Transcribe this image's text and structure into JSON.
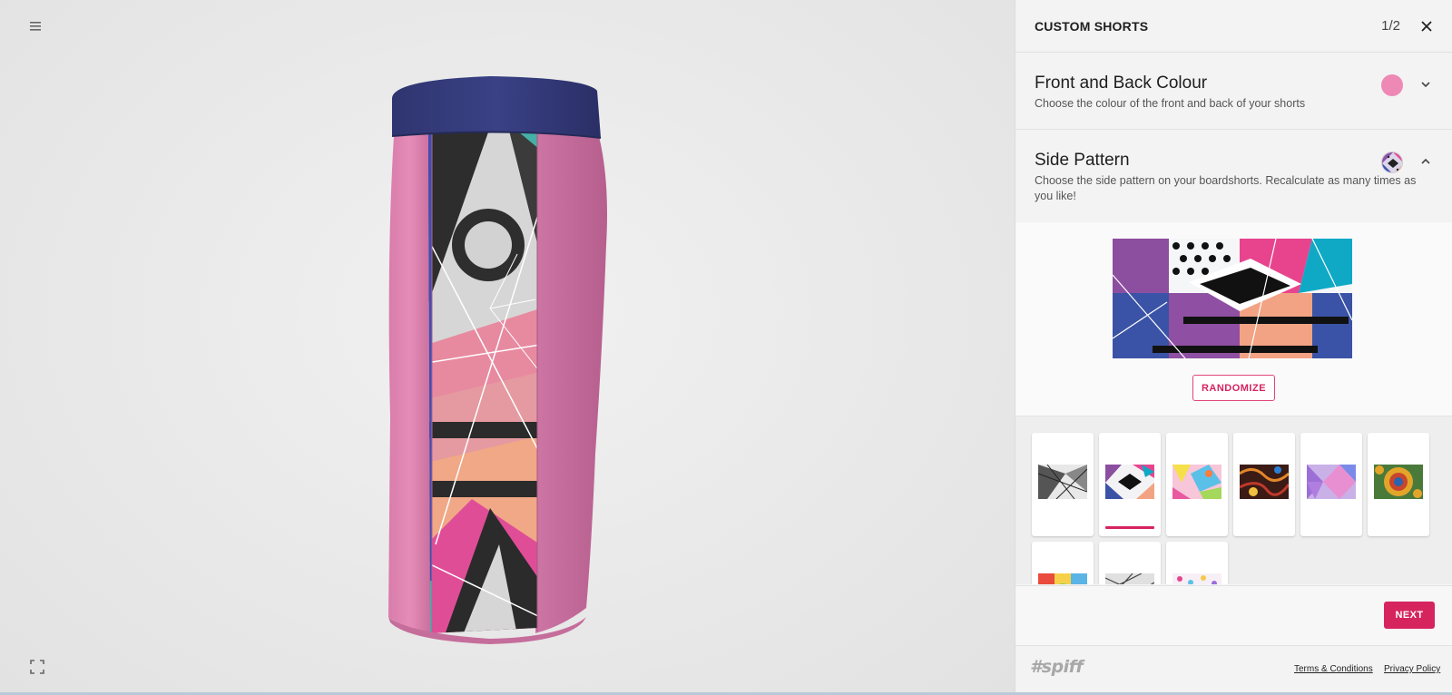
{
  "viewer": {
    "menu_icon": "hamburger-menu-icon",
    "fullscreen_icon": "fullscreen-icon"
  },
  "panel": {
    "title": "CUSTOM SHORTS",
    "step": "1/2",
    "close_icon": "close-icon",
    "sections": {
      "colour": {
        "title": "Front and Back Colour",
        "description": "Choose the colour of the front and back of your shorts",
        "swatch_color": "#ee88b5"
      },
      "pattern": {
        "title": "Side Pattern",
        "description": "Choose the side pattern on your boardshorts. Recalculate as many times as you like!"
      }
    },
    "randomize_label": "RANDOMIZE",
    "next_label": "NEXT",
    "thumbnails": {
      "count": 9,
      "selected_index": 1
    }
  },
  "footer": {
    "logo": "#spiff",
    "terms": "Terms & Conditions",
    "privacy": "Privacy Policy"
  },
  "colors": {
    "accent": "#d6245f",
    "short_pink": "#e286b1",
    "waistband": "#2e3573"
  }
}
